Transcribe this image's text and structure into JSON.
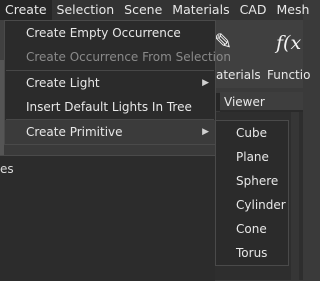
{
  "menubar": {
    "items": [
      "Create",
      "Selection",
      "Scene",
      "Materials",
      "CAD",
      "Mesh"
    ]
  },
  "toolbar": {
    "materials_label": "aterials",
    "functions_label": "Functio",
    "fx_glyph": "f(x",
    "pencil_glyph": "✎"
  },
  "viewer": {
    "tab_label": "Viewer"
  },
  "left_panel": {
    "label": "es"
  },
  "create_menu": {
    "items": [
      {
        "label": "Create Empty Occurrence",
        "state": "enabled"
      },
      {
        "label": "Create Occurrence From Selection",
        "state": "disabled"
      },
      {
        "label": "Create Light",
        "state": "enabled",
        "submenu": true
      },
      {
        "label": "Insert Default Lights In Tree",
        "state": "enabled"
      },
      {
        "label": "Create Primitive",
        "state": "highlighted",
        "submenu": true
      }
    ],
    "submenu_arrow": "▶"
  },
  "primitive_submenu": {
    "items": [
      "Cube",
      "Plane",
      "Sphere",
      "Cylinder",
      "Cone",
      "Torus"
    ]
  }
}
